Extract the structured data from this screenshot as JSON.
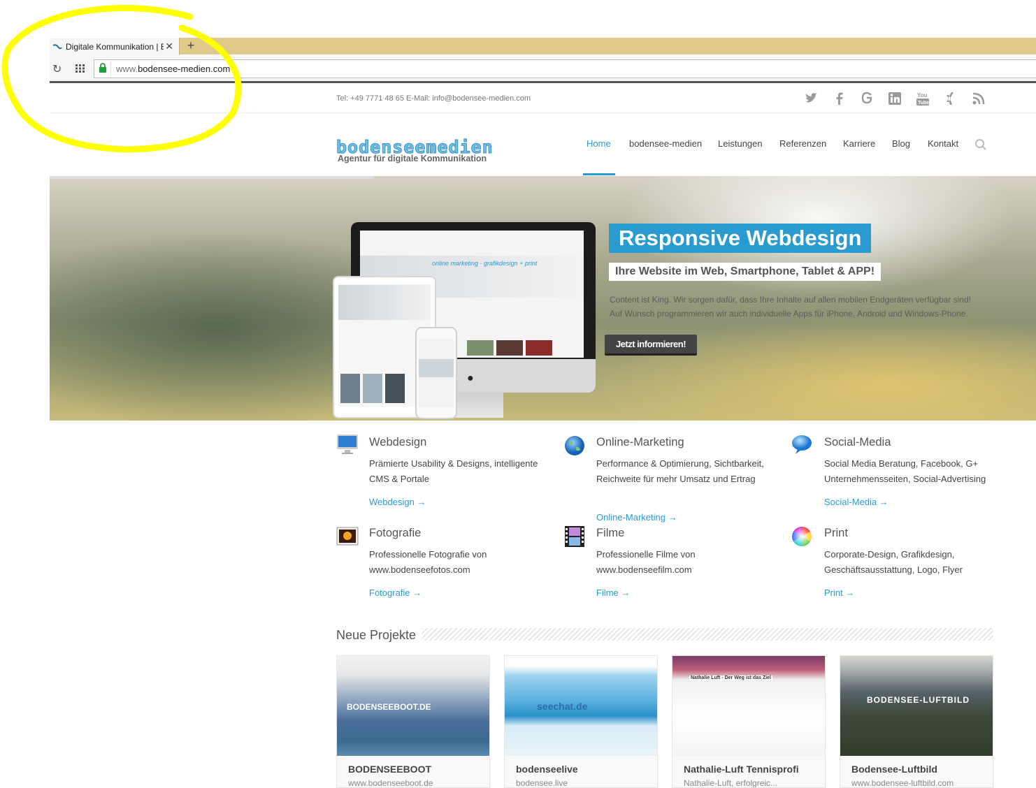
{
  "browser": {
    "tab_title": "Digitale Kommunikation | B",
    "new_tab": "+",
    "close": "✕",
    "url_prefix": "www.",
    "url_main": "bodensee-medien.com",
    "reload": "↻"
  },
  "topbar": {
    "contact": "Tel: +49 7771 48 65   E-Mail: info@bodensee-medien.com",
    "social": [
      "twitter-icon",
      "facebook-icon",
      "google-plus-icon",
      "linkedin-icon",
      "youtube-icon",
      "xing-icon",
      "rss-icon"
    ]
  },
  "logo": {
    "main": "bodenseemedien",
    "sub": "Agentur für digitale Kommunikation"
  },
  "nav": {
    "items": [
      "Home",
      "bodensee-medien",
      "Leistungen",
      "Referenzen",
      "Karriere",
      "Blog",
      "Kontakt"
    ],
    "active": "Home"
  },
  "hero": {
    "title": "Responsive Webdesign",
    "subtitle": "Ihre Website im Web, Smartphone, Tablet & APP!",
    "text_line1": "Content ist King. Wir sorgen dafür, dass Ihre Inhalte auf allen mobilen Endgeräten verfügbar sind!",
    "text_line2": "Auf Wunsch programmieren wir auch individuelle Apps für iPhone, Android und Windows-Phone.",
    "button": "Jetzt informieren!"
  },
  "services": [
    {
      "title": "Webdesign",
      "text": "Prämierte Usability & Designs, intelligente CMS & Portale",
      "link": "Webdesign →",
      "icon": "monitor-icon"
    },
    {
      "title": "Online-Marketing",
      "text": "Performance & Optimierung, Sichtbarkeit, Reichweite für mehr Umsatz und Ertrag",
      "link": "Online-Marketing →",
      "icon": "globe-icon"
    },
    {
      "title": "Social-Media",
      "text": "Social Media Beratung, Facebook, G+ Unternehmensseiten, Social-Advertising",
      "link": "Social-Media →",
      "icon": "speech-bubble-icon"
    },
    {
      "title": "Fotografie",
      "text": "Professionelle Fotografie von www.bodenseefotos.com",
      "link": "Fotografie →",
      "icon": "photo-icon"
    },
    {
      "title": "Filme",
      "text": "Professionelle Filme von www.bodenseefilm.com",
      "link": "Filme →",
      "icon": "film-icon"
    },
    {
      "title": "Print",
      "text": "Corporate-Design, Grafikdesign, Geschäftsausstattung, Logo, Flyer",
      "link": "Print →",
      "icon": "color-wheel-icon"
    }
  ],
  "projects": {
    "title": "Neue Projekte",
    "items": [
      {
        "title": "BODENSEEBOOT",
        "sub": "www.bodenseeboot.de",
        "overlay": "BODENSEEBOOT.DE"
      },
      {
        "title": "bodenseelive",
        "sub": "bodensee.live",
        "overlay": "seechat.de"
      },
      {
        "title": "Nathalie-Luft Tennisprofi",
        "sub": "Nathalie-Luft, erfolgreic...",
        "overlay": "Nathalie Luft - Der Weg ist das Ziel"
      },
      {
        "title": "Bodensee-Luftbild",
        "sub": "www.bodensee-luftbild.com",
        "overlay": "BODENSEE-LUFTBILD"
      }
    ]
  },
  "colors": {
    "accent": "#2a9bd1",
    "tabstrip": "#e1c98a",
    "annotation": "#ffff00"
  }
}
